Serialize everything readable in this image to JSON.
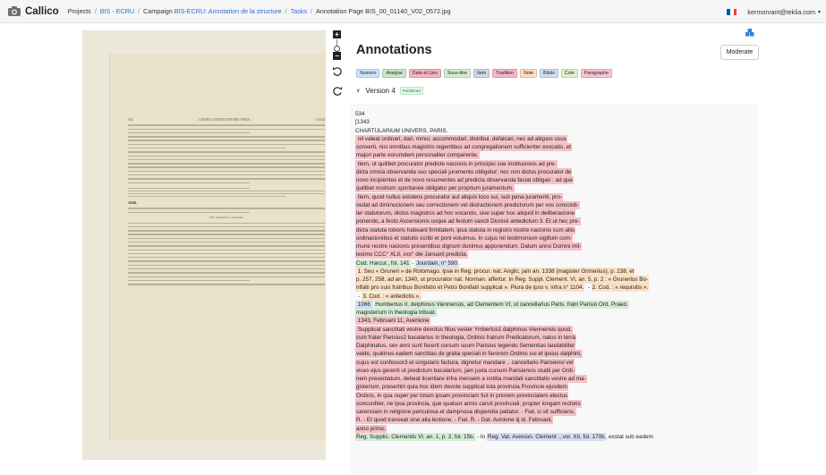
{
  "nav": {
    "brand": "Callico",
    "breadcrumb": [
      {
        "label": "Projects",
        "link": false
      },
      {
        "label": "BIS - ECRU",
        "link": true
      },
      {
        "label": "Campaign ",
        "link": false
      },
      {
        "label": "BIS-ECRU: Annotation de la structure",
        "link": true
      },
      {
        "label": "Tasks",
        "link": true
      },
      {
        "label": "Annotation Page BIS_00_01140_V02_0572.jpg",
        "link": false
      }
    ],
    "user_email": "kermorvant@teklia.com",
    "flag_colors": [
      "#0055a4",
      "#ffffff",
      "#ef4135"
    ]
  },
  "viewer": {
    "header_left": "534",
    "header_center": "CHARTULARIUM UNIVERS. PARIS.",
    "header_right": "[1343]",
    "entry_number": "1066.",
    "entry_date": "1343. Februarii 11. Avenione."
  },
  "panel": {
    "title": "Annotations",
    "moderate_label": "Moderate",
    "version_label": "Version 4",
    "version_badge": "Published",
    "tags": [
      {
        "label": "Numéro",
        "color": "#cce5ff"
      },
      {
        "label": "Analyse",
        "color": "#c8e6c9"
      },
      {
        "label": "Date et Lieu",
        "color": "#f8b4c0"
      },
      {
        "label": "Sous-titre",
        "color": "#d6ecd2"
      },
      {
        "label": "Item",
        "color": "#cfd8e6"
      },
      {
        "label": "Tradition",
        "color": "#f5b8c8"
      },
      {
        "label": "Note",
        "color": "#fde0c2"
      },
      {
        "label": "Biblio",
        "color": "#d1dcf5"
      },
      {
        "label": "Cote",
        "color": "#e2f0cb"
      },
      {
        "label": "Paragraphe",
        "color": "#f8c4d0"
      }
    ]
  },
  "transcription": [
    [
      {
        "t": "534",
        "c": ""
      }
    ],
    [
      {
        "t": "[1343",
        "c": ""
      }
    ],
    [
      {
        "t": "CHARTULARIUM UNIVERS. PARIS.",
        "c": ""
      }
    ],
    [
      {
        "t": " nil valeat ordinari, dari, minui, accommodari, distribui, defalcari, nec ad aliquos usus",
        "c": "paragraphe"
      }
    ],
    [
      {
        "t": "converti, nisi omnibus magistris regentibus ad congregationem sufficienter evocatis, et",
        "c": "paragraphe"
      }
    ],
    [
      {
        "t": "majori parte eorumdem personaliter comparente.",
        "c": "paragraphe"
      }
    ],
    [
      {
        "t": " Item, ut quilibet procurator predicte nacionis in principio sue institucionis ad pre-",
        "c": "paragraphe"
      }
    ],
    [
      {
        "t": "dicta omnia observanda suo speciali juramento obligetur; nec non dictus procurator de",
        "c": "paragraphe"
      }
    ],
    [
      {
        "t": "novo incipientes et de novo resumentes ad predicta observanda faciat obligari : ad que",
        "c": "paragraphe"
      }
    ],
    [
      {
        "t": "quilibet nostrum spontanee obligatur per proprium juramentum.",
        "c": "paragraphe"
      }
    ],
    [
      {
        "t": " Item, quod nullus existens procurator aut aliquis loco sui, sub pena juramenti, pro-",
        "c": "paragraphe"
      }
    ],
    [
      {
        "t": "cedat ad diminucionem seu correctionem vel distractionem predictorum per vos concordi-",
        "c": "paragraphe"
      }
    ],
    [
      {
        "t": "ter statutorum, dictos magistros ad hoc vocando, sive super hoc aliquid in deliberacione",
        "c": "paragraphe"
      }
    ],
    [
      {
        "t": "ponendo, a festo Ascensionis usque ad festum sancti Dionisii antedictum 3. Et ut hec pre-",
        "c": "paragraphe"
      }
    ],
    [
      {
        "t": "dicta statuta roboris habeant firmitatem, ipsa statuta in registro nostre nacionis cum aliis",
        "c": "paragraphe"
      }
    ],
    [
      {
        "t": "ordinacionibus et statutis scribi et poni voluimus. In cujus rei testimonium sigillum com-",
        "c": "paragraphe"
      }
    ],
    [
      {
        "t": "mune nostre nacionis presentibus dignum duximus apponendum. Datum anno Domini mil-",
        "c": "paragraphe"
      }
    ],
    [
      {
        "t": "lesimo CCC° XLII, xxx° die Januarii predicta.",
        "c": "paragraphe"
      }
    ],
    [
      {
        "t": "Cod. Harcur., fol. 141",
        "c": "cote"
      },
      {
        "t": " - ",
        "c": ""
      },
      {
        "t": "Jourdain, n° 590",
        "c": "biblio"
      },
      {
        "t": ".",
        "c": ""
      }
    ],
    [
      {
        "t": " 1. Seu « Gruneri » de Rotomago. Ipse in Reg. procur. nat. Anglic. jam an. 1338 (magister Grimerius), p. 238, et",
        "c": "note"
      }
    ],
    [
      {
        "t": "p. 257, 258, ad an. 1340, ut procurator nat. Norman. affertur. In Reg. Suppl. Clement. VI, an. 5, p. 2 : « Grunerius Bo-",
        "c": "note"
      }
    ],
    [
      {
        "t": "nifatii pro suis fratribus Bonifatio et Petro Bonifatii supplicat ». Plura de ipso v. infra n° 1104.",
        "c": "note"
      },
      {
        "t": "  - ",
        "c": ""
      },
      {
        "t": "2. Cod. : « requisitis ».",
        "c": "note"
      }
    ],
    [
      {
        "t": "  - ",
        "c": ""
      },
      {
        "t": "3. Cod. : « antedictis ».",
        "c": "note"
      }
    ],
    [
      {
        "t": " 1066 ",
        "c": "numero"
      },
      {
        "t": " ",
        "c": ""
      },
      {
        "t": "Humbertus II, delphinus Viennensis, ad Clementem VI, ut cancellarius Paris. fratri Parisio Ord. Praed.",
        "c": "titre"
      }
    ],
    [
      {
        "t": "magisterium in theologia tribuat.",
        "c": "titre"
      }
    ],
    [
      {
        "t": " 1343, Februarii 11, Avenione",
        "c": "paragraphe"
      }
    ],
    [
      {
        "t": " Supplicat sanctitati vestre devotus filius vester Ymbertus1 dalphinus Viennensis quod,",
        "c": "paragraphe"
      }
    ],
    [
      {
        "t": "cum frater Parisius2 bacalarius in theologia, Ordinis fratrum Predicatorum, natus in terra",
        "c": "paragraphe"
      }
    ],
    [
      {
        "t": "Dalphinatus, sex anni sunt fecerit cursum suum Parisius legendo Sententias laudabiliter",
        "c": "paragraphe"
      }
    ],
    [
      {
        "t": "valde, quatinus eadem sanctitas de gratia speciali in favorem Ordinis sui et ipsius dalphini,",
        "c": "paragraphe"
      }
    ],
    [
      {
        "t": "cujus est confessor3 et singularis factura, dignetur mandare .. cancellario Parisiensi vel",
        "c": "paragraphe"
      }
    ],
    [
      {
        "t": "vices ejus gerenti ut predictum bacalarium, jam juxta cursum Parisiensis studii per Ordi-",
        "c": "paragraphe"
      }
    ],
    [
      {
        "t": "nem presentatum, debeat licentiare infra mensem a notitia mandati sanctitatis vestre ad ma-",
        "c": "paragraphe"
      }
    ],
    [
      {
        "t": "gisterium, presertim quia hoc idem devote supplicat tota provincia Provincie ejusdem",
        "c": "paragraphe"
      }
    ],
    [
      {
        "t": "Ordinis, in qua nuper per totam ipsam provinciam fuit in priorem provincialem electus",
        "c": "paragraphe"
      }
    ],
    [
      {
        "t": "concorditer, ne ipsa provincia, que quatuor annis caruit provinciali, propter longam rectoris",
        "c": "paragraphe"
      }
    ],
    [
      {
        "t": "carenciam in religione periculosa et dampnosa dispendia patiatur. - Fiat, si sit sufficiens.",
        "c": "paragraphe"
      }
    ],
    [
      {
        "t": "R. - Et quod transeat sine alia lectione. - Fiat. R. - Dat. Avinione iij id. Februarii,",
        "c": "paragraphe"
      }
    ],
    [
      {
        "t": "anno primo.",
        "c": "paragraphe"
      }
    ],
    [
      {
        "t": "Reg. Supplic. Clementis VI, an. 1, p. 2, fol. 15b.",
        "c": "cote"
      },
      {
        "t": " - In ",
        "c": ""
      },
      {
        "t": "Reg. Vat. Avenion. Clement ., vol. XII, fol. 170b",
        "c": "biblio"
      },
      {
        "t": ", exstat sub eadem",
        "c": ""
      }
    ]
  ]
}
